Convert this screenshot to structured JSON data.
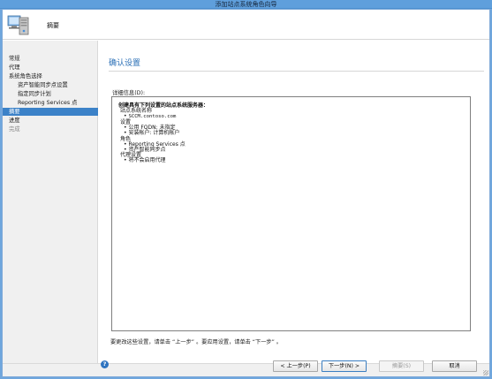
{
  "window": {
    "title": "添加站点系统角色向导"
  },
  "header": {
    "title": "摘要",
    "icon": "server-computer-icon"
  },
  "nav": {
    "items": [
      {
        "label": "常规",
        "state": "normal",
        "indent": false
      },
      {
        "label": "代理",
        "state": "normal",
        "indent": false
      },
      {
        "label": "系统角色选择",
        "state": "normal",
        "indent": false
      },
      {
        "label": "资产智能同步点设置",
        "state": "normal",
        "indent": true
      },
      {
        "label": "指定同步计划",
        "state": "normal",
        "indent": true
      },
      {
        "label": "Reporting Services 点",
        "state": "normal",
        "indent": true
      },
      {
        "label": "摘要",
        "state": "active",
        "indent": false
      },
      {
        "label": "进度",
        "state": "normal",
        "indent": false
      },
      {
        "label": "完成",
        "state": "disabled",
        "indent": false
      }
    ]
  },
  "content": {
    "heading": "确认设置",
    "details_label": "详细信息(D):",
    "details": {
      "intro": "创建具有下列设置的站点系统服务器：",
      "server_name_label": "站点系统名称",
      "server_name": "SCCM.contoso.com",
      "settings_label": "设置",
      "settings": [
        "公用 FQDN: 未指定",
        "安装帐户: 计算机帐户"
      ],
      "roles_label": "角色",
      "roles": [
        "Reporting Services 点",
        "资产智能同步点"
      ],
      "proxy_label": "代理设置",
      "proxy": [
        "将不会启用代理"
      ]
    },
    "instructions": "要更改这些设置，请单击 “上一步” 。要应用设置，请单击 “下一步” 。"
  },
  "footer": {
    "help_icon": "help-icon",
    "buttons": {
      "prev": "< 上一步(P)",
      "next": "下一步(N) >",
      "summary": "摘要(S)",
      "cancel": "取消"
    }
  },
  "colors": {
    "accent": "#3c82c8",
    "heading": "#2a6fb6",
    "titlebar": "#5f9fdc"
  }
}
